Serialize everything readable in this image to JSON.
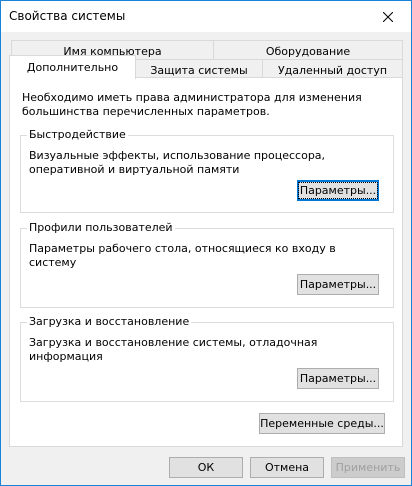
{
  "window": {
    "title": "Свойства системы"
  },
  "tabs": [
    {
      "label": "Имя компьютера",
      "active": false
    },
    {
      "label": "Оборудование",
      "active": false
    },
    {
      "label": "Дополнительно",
      "active": true
    },
    {
      "label": "Защита системы",
      "active": false
    },
    {
      "label": "Удаленный доступ",
      "active": false
    }
  ],
  "advanced": {
    "note": "Необходимо иметь права администратора для изменения большинства перечисленных параметров.",
    "performance": {
      "title": "Быстродействие",
      "description": "Визуальные эффекты, использование процессора, оперативной и виртуальной памяти",
      "button": "Параметры..."
    },
    "profiles": {
      "title": "Профили пользователей",
      "description": "Параметры рабочего стола, относящиеся ко входу в систему",
      "button": "Параметры..."
    },
    "startup": {
      "title": "Загрузка и восстановление",
      "description": "Загрузка и восстановление системы, отладочная информация",
      "button": "Параметры..."
    },
    "env_button": "Переменные среды..."
  },
  "footer": {
    "ok": "ОК",
    "cancel": "Отмена",
    "apply": "Применить"
  },
  "colors": {
    "accent": "#0078d7",
    "window_border": "#1883d7"
  },
  "icons": {
    "close": "close-icon"
  }
}
